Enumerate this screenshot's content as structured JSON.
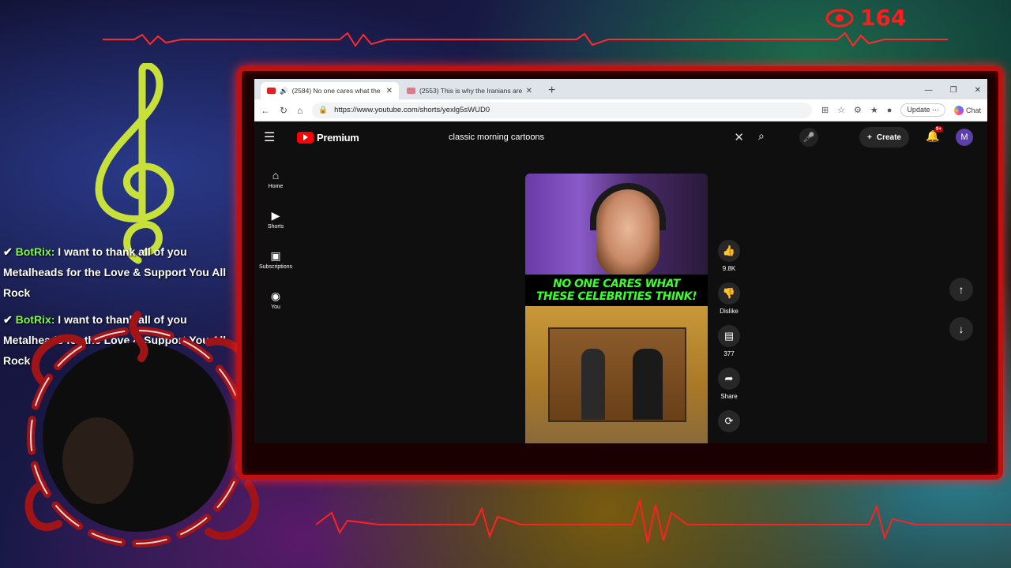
{
  "overlay": {
    "viewer_count": "164",
    "chat": [
      {
        "user": "BotRix:",
        "text": "I want to thank all of you Metalheads for the Love & Support You All Rock"
      },
      {
        "user": "BotRix:",
        "text": "I want to thank all of you Metalheads for the Love & Support You All Rock"
      }
    ],
    "colors": {
      "accent_red": "#ff1c1c",
      "chat_user": "#7cfc3c",
      "frame": "#c01010"
    }
  },
  "browser": {
    "tabs": [
      {
        "title": "(2584) No one cares what the",
        "active": true
      },
      {
        "title": "(2553) This is why the Iranians are",
        "active": false
      }
    ],
    "new_tab": "+",
    "url": "https://www.youtube.com/shorts/yexlg5sWUD0",
    "update_label": "Update",
    "chat_label": "Chat"
  },
  "youtube": {
    "brand": "Premium",
    "search_query": "classic morning cartoons",
    "create_label": "Create",
    "notif_badge": "9+",
    "avatar_letter": "M",
    "nav": [
      {
        "label": "Home",
        "icon": "home-icon"
      },
      {
        "label": "Shorts",
        "icon": "shorts-icon"
      },
      {
        "label": "Subscriptions",
        "icon": "subscriptions-icon"
      },
      {
        "label": "You",
        "icon": "you-icon"
      }
    ],
    "short": {
      "caption_line1": "NO ONE CARES WHAT",
      "caption_line2": "THESE CELEBRITIES THINK!"
    },
    "actions": {
      "likes": "9.8K",
      "dislike": "Dislike",
      "comments": "377",
      "share": "Share"
    }
  }
}
